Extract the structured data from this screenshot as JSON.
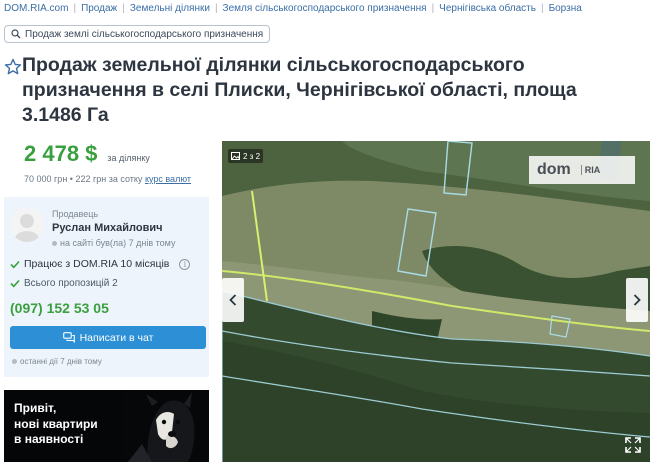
{
  "breadcrumbs": [
    "DOM.RIA.com",
    "Продаж",
    "Земельні ділянки",
    "Земля сільськогосподарського призначення",
    "Чернігівська область",
    "Борзна"
  ],
  "filter_tag": {
    "label": "Продаж землі сільськогосподарського призначення",
    "icon": "search-icon"
  },
  "listing": {
    "title": "Продаж земельної ділянки сільськогосподарського призначення в селі Плиски, Чернігівської області, площа 3.1486 Га",
    "price": "2 478 $",
    "price_note": "за ділянку",
    "price_details": "70 000 грн • 222 грн за сотку",
    "currency_link": "курс валют"
  },
  "seller": {
    "label": "Продавець",
    "name": "Руслан Михайлович",
    "online_status": "на сайті був(ла) 7 днів тому",
    "works_with": "Працює з DOM.RIA 10 місяців",
    "offers": "Всього пропозицій 2",
    "phone": "(097) 152 53 05",
    "chat_button": "Написати в чат",
    "last_actions": "останні дії 7 днів тому"
  },
  "banner": {
    "text_line1": "Привіт,",
    "text_line2": "нові квартири",
    "text_line3": "в наявності"
  },
  "gallery": {
    "counter": "2 з 2",
    "watermark_main": "dom",
    "watermark_sub": "RIA",
    "current_photo": 2,
    "total_photos": 2
  },
  "colors": {
    "price_green": "#3aa03f",
    "link_blue": "#3b6ea5",
    "chat_button": "#2d8fd6",
    "seller_box_bg": "#eef4fb"
  }
}
